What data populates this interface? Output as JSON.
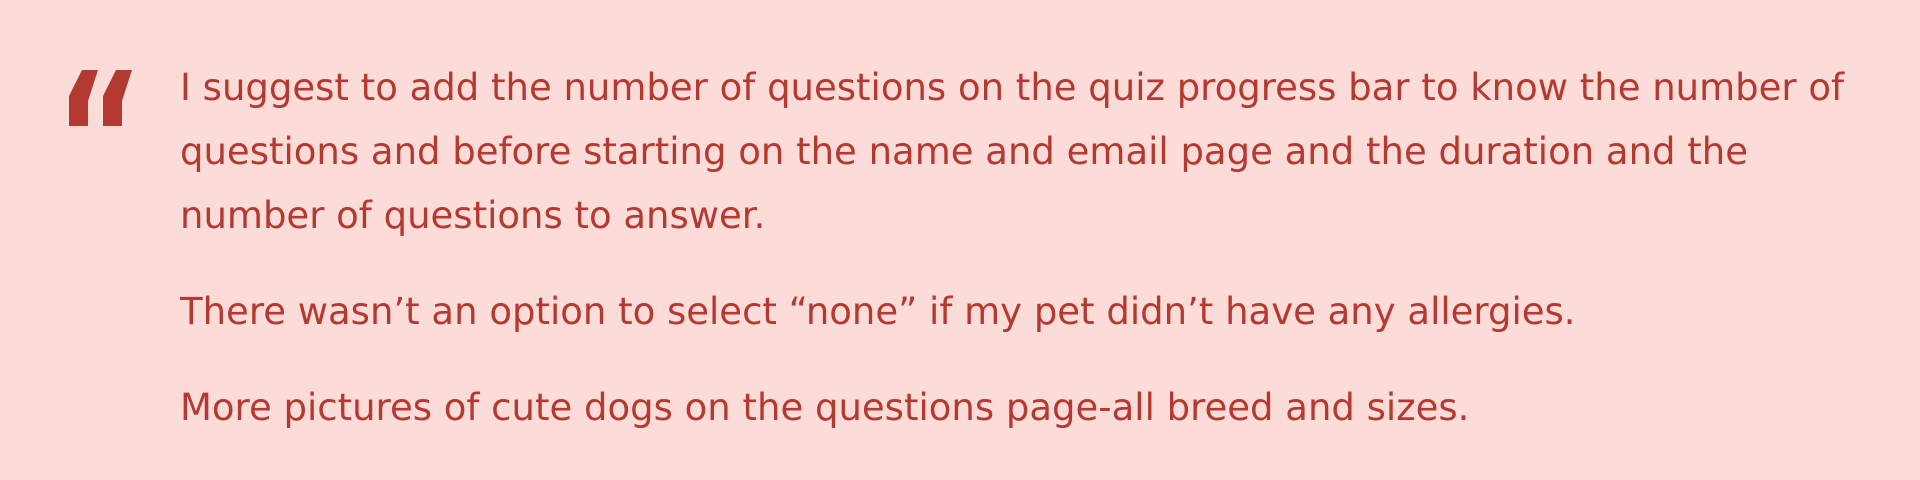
{
  "colors": {
    "background": "#fcdcd8",
    "text": "#b43a31",
    "quote_mark": "#b43a31"
  },
  "quote": {
    "icon": "open-quote-icon",
    "paragraphs": [
      "I suggest to add the number of questions on the quiz progress bar to know the number of questions and before starting on the name and email page and the duration and the number of questions to answer.",
      "There wasn’t an option to select “none” if my pet didn’t have any allergies.",
      "More pictures of cute dogs on the questions page-all breed and sizes."
    ]
  }
}
